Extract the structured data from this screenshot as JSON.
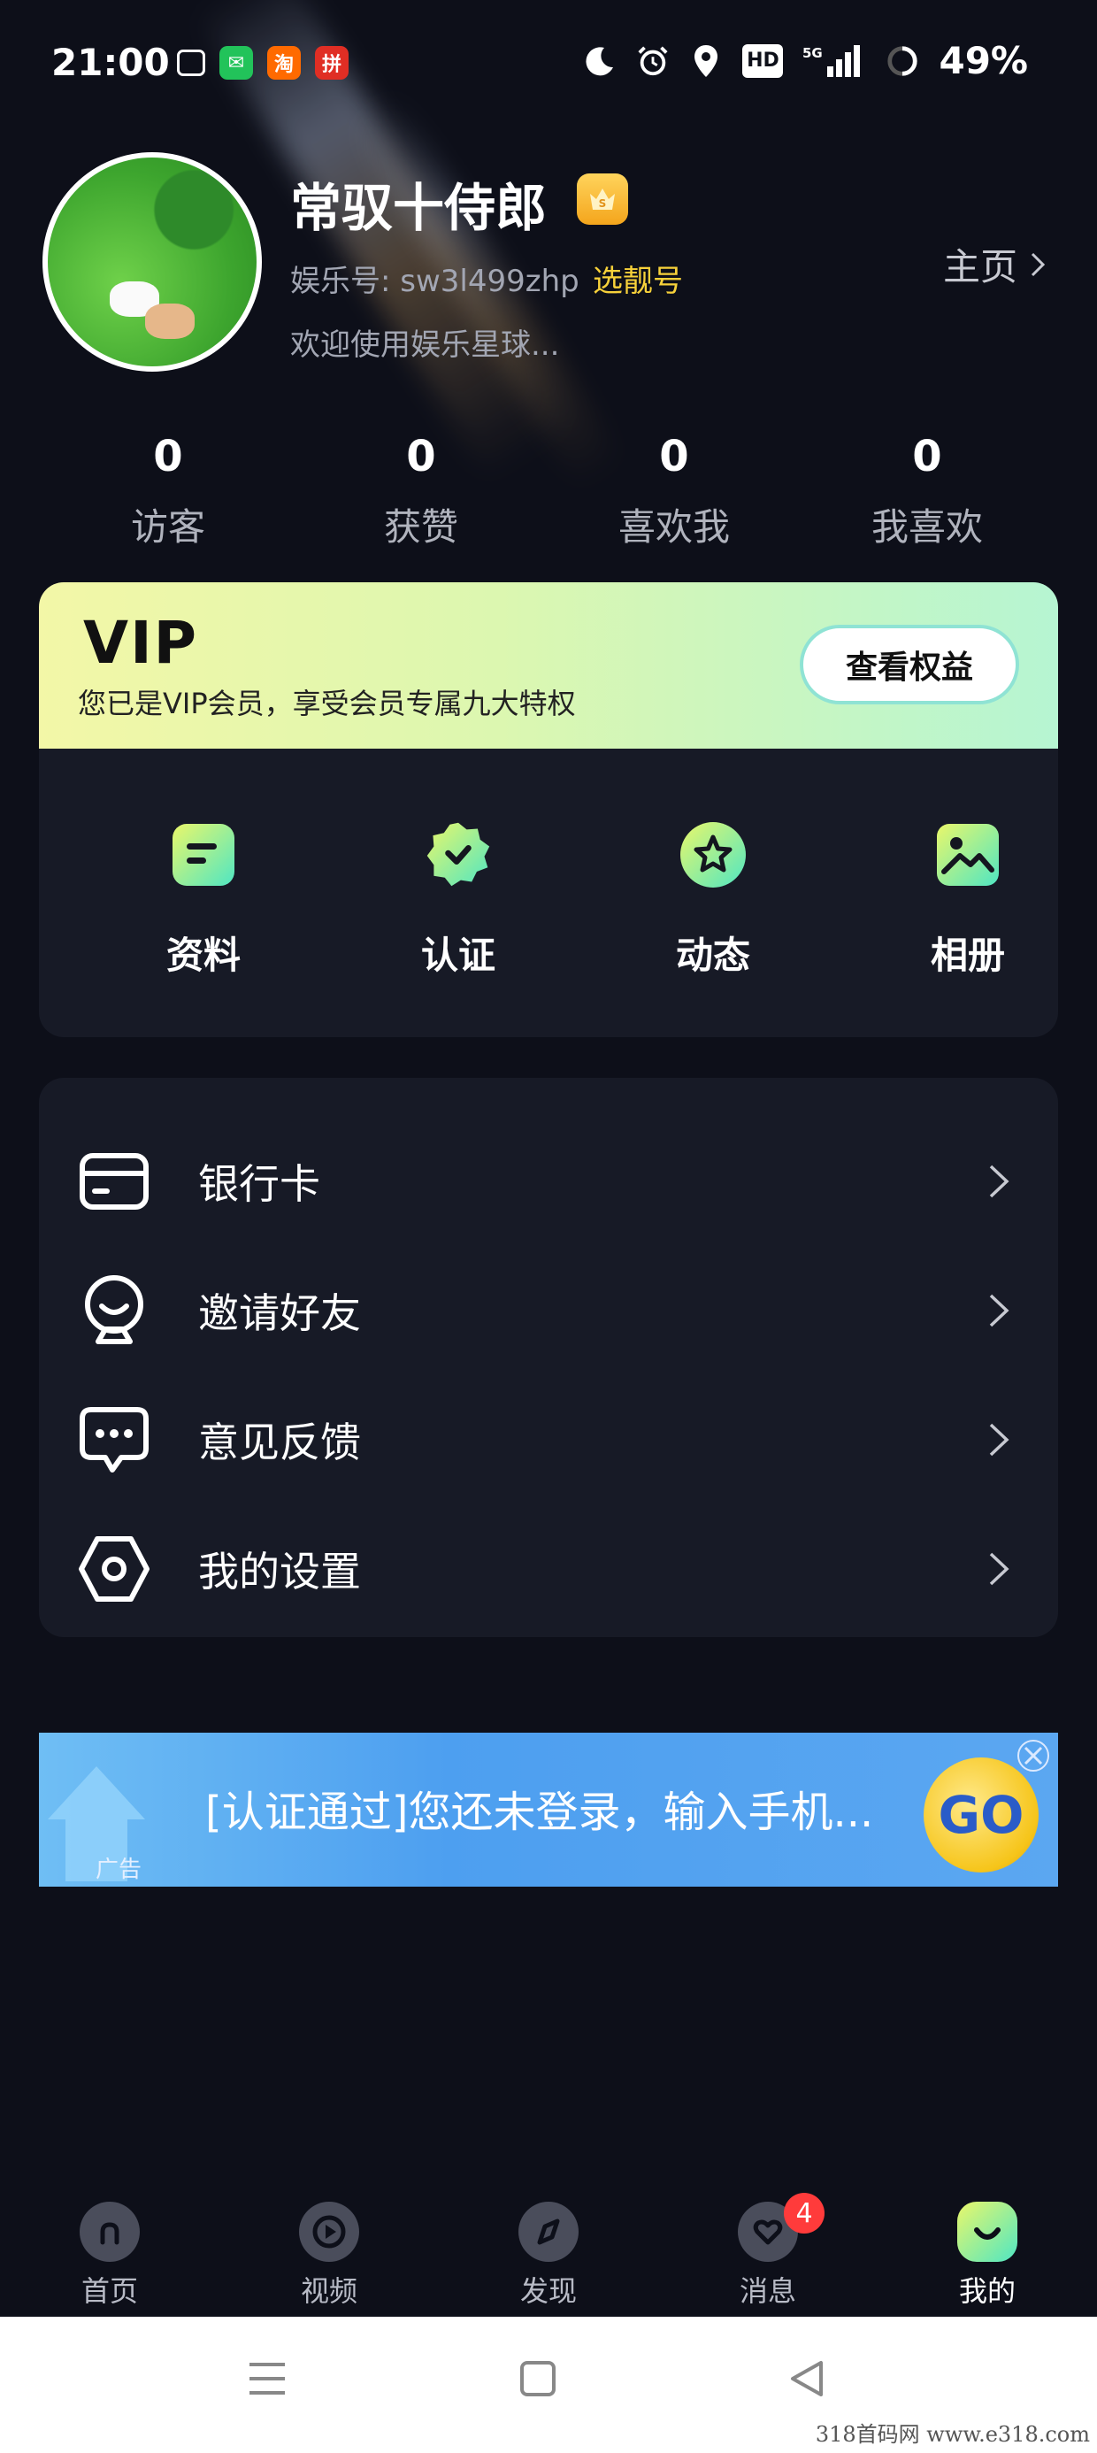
{
  "status_bar": {
    "time": "21:00",
    "battery": "49%",
    "apps": [
      {
        "name": "tv",
        "glyph": "▫",
        "color": "#ffffff"
      },
      {
        "name": "message",
        "glyph": "✉",
        "color": "#22c35a"
      },
      {
        "name": "taobao",
        "glyph": "淘",
        "color": "#ff6a00"
      },
      {
        "name": "pinduoduo",
        "glyph": "拼",
        "color": "#e02e24"
      }
    ],
    "icons": [
      "moon-icon",
      "alarm-icon",
      "location-icon",
      "hd-icon",
      "5g-signal-icon",
      "battery-icon"
    ],
    "hd_label": "HD",
    "net_label": "5G"
  },
  "profile": {
    "nickname": "常驭十侍郎",
    "id_label": "娱乐号: sw3l499zhp",
    "pick_number": "选靓号",
    "welcome": "欢迎使用娱乐星球...",
    "homepage": "主页",
    "crown_glyph": "S"
  },
  "stats": [
    {
      "value": "0",
      "label": "访客"
    },
    {
      "value": "0",
      "label": "获赞"
    },
    {
      "value": "0",
      "label": "喜欢我"
    },
    {
      "value": "0",
      "label": "我喜欢"
    }
  ],
  "vip": {
    "title": "VIP",
    "desc": "您已是VIP会员，享受会员专属九大特权",
    "button": "查看权益"
  },
  "quick_actions": [
    {
      "label": "资料",
      "icon": "profile-doc-icon"
    },
    {
      "label": "认证",
      "icon": "verified-badge-icon"
    },
    {
      "label": "动态",
      "icon": "star-icon"
    },
    {
      "label": "相册",
      "icon": "photo-icon"
    }
  ],
  "menu": [
    {
      "label": "银行卡",
      "icon": "bank-card-icon"
    },
    {
      "label": "邀请好友",
      "icon": "invite-friend-icon"
    },
    {
      "label": "意见反馈",
      "icon": "feedback-icon"
    },
    {
      "label": "我的设置",
      "icon": "settings-icon"
    }
  ],
  "ad": {
    "text": "[认证通过]您还未登录，输入手机...",
    "tag": "广告",
    "go": "GO"
  },
  "tabs": [
    {
      "label": "首页",
      "icon": "home-icon"
    },
    {
      "label": "视频",
      "icon": "video-icon"
    },
    {
      "label": "发现",
      "icon": "compass-icon"
    },
    {
      "label": "消息",
      "icon": "message-heart-icon",
      "badge": "4"
    },
    {
      "label": "我的",
      "icon": "me-smile-icon",
      "active": true
    }
  ],
  "watermark": "318首码网 www.e318.com",
  "colors": {
    "background": "#0d0f19",
    "card": "#171a26",
    "accent_yellow": "#f7d13a",
    "vip_gradient_start": "#f3f7a7",
    "vip_gradient_end": "#b6f5d2",
    "badge_red": "#ff3b3b"
  }
}
